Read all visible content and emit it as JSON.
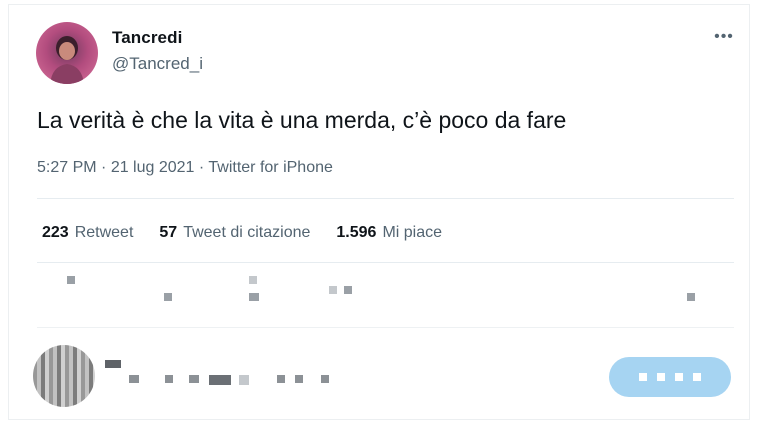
{
  "tweet": {
    "display_name": "Tancredi",
    "handle": "@Tancred_i",
    "more_icon": "•••",
    "text": "La verità è che la vita è una merda, c’è poco da fare",
    "time": "5:27 PM",
    "separator": " · ",
    "date": "21 lug 2021",
    "source": "Twitter for iPhone"
  },
  "stats": [
    {
      "count": "223",
      "label": "Retweet"
    },
    {
      "count": "57",
      "label": "Tweet di citazione"
    },
    {
      "count": "1.596",
      "label": "Mi piace"
    }
  ],
  "colors": {
    "text": "#0f1419",
    "secondary": "#536471",
    "divider": "#e6ecf0",
    "reply_button": "#a6d4f2"
  },
  "icons": {
    "more": "more-horizontal-icon",
    "reply_actions": [
      "reply-icon",
      "retweet-icon",
      "like-icon",
      "share-icon"
    ]
  }
}
